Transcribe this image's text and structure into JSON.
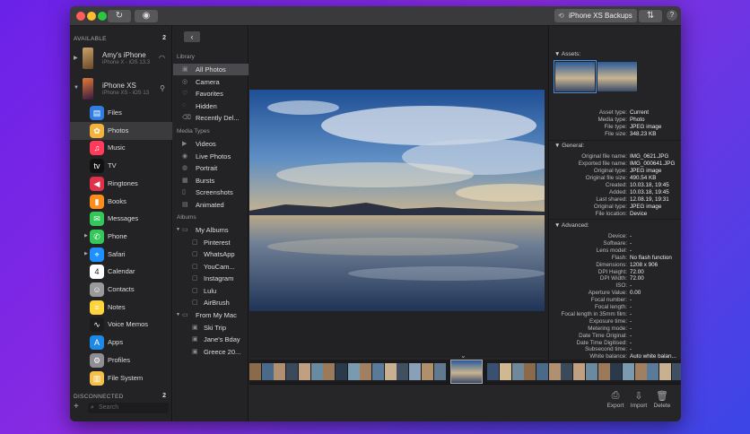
{
  "toolbar": {
    "refresh_icon": "↻",
    "eye_icon": "◉",
    "device_button": "iPhone XS Backups",
    "transfer_icon": "⇅",
    "help": "?"
  },
  "devices": {
    "available_label": "AVAILABLE",
    "available_count": "2",
    "disconnected_label": "DISCONNECTED",
    "disconnected_count": "2",
    "list": [
      {
        "name": "Amy's iPhone",
        "sub": "iPhone X - iOS 13.3",
        "conn": "wifi-icon"
      },
      {
        "name": "iPhone XS",
        "sub": "iPhone XS - iOS 13",
        "conn": "usb-icon"
      }
    ],
    "search_placeholder": "Search"
  },
  "categories": [
    {
      "label": "Files",
      "icon": "files-icon",
      "color": "#2f7de1",
      "glyph": "▤"
    },
    {
      "label": "Photos",
      "icon": "photos-icon",
      "color": "#f2b33d",
      "glyph": "✿",
      "selected": true
    },
    {
      "label": "Music",
      "icon": "music-icon",
      "color": "#ff3b5c",
      "glyph": "♫"
    },
    {
      "label": "TV",
      "icon": "tv-icon",
      "color": "#111111",
      "glyph": "tv"
    },
    {
      "label": "Ringtones",
      "icon": "ringtones-icon",
      "color": "#e0304a",
      "glyph": "◀"
    },
    {
      "label": "Books",
      "icon": "books-icon",
      "color": "#ff8c1a",
      "glyph": "▮"
    },
    {
      "label": "Messages",
      "icon": "messages-icon",
      "color": "#34c759",
      "glyph": "✉"
    },
    {
      "label": "Phone",
      "icon": "phone-icon",
      "color": "#34c759",
      "glyph": "✆"
    },
    {
      "label": "Safari",
      "icon": "safari-icon",
      "color": "#1e90ff",
      "glyph": "⌖"
    },
    {
      "label": "Calendar",
      "icon": "calendar-icon",
      "color": "#ffffff",
      "glyph": "4"
    },
    {
      "label": "Contacts",
      "icon": "contacts-icon",
      "color": "#9a9a9a",
      "glyph": "☺"
    },
    {
      "label": "Notes",
      "icon": "notes-icon",
      "color": "#ffd43b",
      "glyph": "≡"
    },
    {
      "label": "Voice Memos",
      "icon": "voice-memos-icon",
      "color": "#1c1c1e",
      "glyph": "∿"
    },
    {
      "label": "Apps",
      "icon": "apps-icon",
      "color": "#1e88e5",
      "glyph": "A"
    },
    {
      "label": "Profiles",
      "icon": "profiles-icon",
      "color": "#8e8e93",
      "glyph": "⚙"
    },
    {
      "label": "File System",
      "icon": "file-system-icon",
      "color": "#f5c04a",
      "glyph": "▥"
    }
  ],
  "library": {
    "library_head": "Library",
    "media_head": "Media Types",
    "albums_head": "Albums",
    "library_items": [
      {
        "label": "All Photos",
        "icon": "photo-icon"
      },
      {
        "label": "Camera",
        "icon": "camera-icon"
      },
      {
        "label": "Favorites",
        "icon": "heart-icon"
      },
      {
        "label": "Hidden",
        "icon": "eye-slash-icon"
      },
      {
        "label": "Recently Del...",
        "icon": "trash-icon"
      }
    ],
    "media_items": [
      {
        "label": "Videos",
        "icon": "video-icon"
      },
      {
        "label": "Live Photos",
        "icon": "live-photo-icon"
      },
      {
        "label": "Portrait",
        "icon": "portrait-icon"
      },
      {
        "label": "Bursts",
        "icon": "burst-icon"
      },
      {
        "label": "Screenshots",
        "icon": "screenshot-icon"
      },
      {
        "label": "Animated",
        "icon": "animated-icon"
      }
    ],
    "my_albums": "My Albums",
    "my_album_items": [
      "Pinterest",
      "WhatsApp",
      "YouCam...",
      "Instagram",
      "Lulu",
      "AirBrush"
    ],
    "from_mac": "From My Mac",
    "mac_items": [
      "Ski Trip",
      "Jane's Bday",
      "Greece 20..."
    ]
  },
  "actions": {
    "export": "Export",
    "import": "Import",
    "delete": "Delete"
  },
  "info": {
    "assets_head": "Assets:",
    "general_head": "General:",
    "advanced_head": "Advanced:",
    "assets": [
      {
        "k": "Asset type:",
        "v": "Current"
      },
      {
        "k": "Media type:",
        "v": "Photo"
      },
      {
        "k": "File type:",
        "v": "JPEG image"
      },
      {
        "k": "File size:",
        "v": "348.23 KB"
      }
    ],
    "general": [
      {
        "k": "Original file name:",
        "v": "IMG_0621.JPG"
      },
      {
        "k": "Exported file name:",
        "v": "IMG_000641.JPG"
      },
      {
        "k": "Original type:",
        "v": "JPEG image"
      },
      {
        "k": "Original file size:",
        "v": "490.54 KB"
      },
      {
        "k": "Created:",
        "v": "10.03.18, 19:45"
      },
      {
        "k": "Added:",
        "v": "10.03.18, 19:45"
      },
      {
        "k": "Last shared:",
        "v": "12.08.19, 19:31"
      },
      {
        "k": "Original type:",
        "v": "JPEG image"
      },
      {
        "k": "File location:",
        "v": "Device"
      }
    ],
    "advanced": [
      {
        "k": "Device:",
        "v": "-"
      },
      {
        "k": "Software:",
        "v": "-"
      },
      {
        "k": "Lens model:",
        "v": "-"
      },
      {
        "k": "Flash:",
        "v": "No flash function"
      },
      {
        "k": "Dimensions:",
        "v": "1208 x 906"
      },
      {
        "k": "DPI Height:",
        "v": "72.00"
      },
      {
        "k": "DPI Width:",
        "v": "72.00"
      },
      {
        "k": "ISO:",
        "v": "-"
      },
      {
        "k": "Aperture Value:",
        "v": "0.00"
      },
      {
        "k": "Focal number:",
        "v": "-"
      },
      {
        "k": "Focal length:",
        "v": "-"
      },
      {
        "k": "Focal length in 35mm film:",
        "v": "-"
      },
      {
        "k": "Exposure time:",
        "v": "-"
      },
      {
        "k": "Metering mode:",
        "v": "-"
      },
      {
        "k": "Date Time Original:",
        "v": "-"
      },
      {
        "k": "Date Time Digitised:",
        "v": "-"
      },
      {
        "k": "Subsecond time:",
        "v": "-"
      },
      {
        "k": "White balance:",
        "v": "Auto white balan..."
      }
    ]
  }
}
